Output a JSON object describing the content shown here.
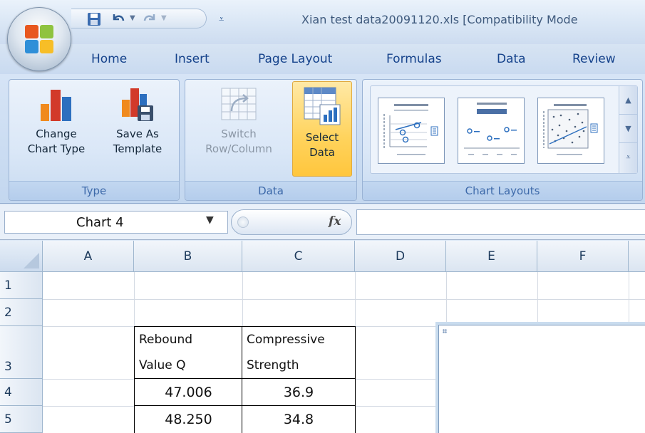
{
  "window": {
    "title": "Xian test data20091120.xls  [Compatibility Mode"
  },
  "tabs": [
    "Home",
    "Insert",
    "Page Layout",
    "Formulas",
    "Data",
    "Review"
  ],
  "ribbon": {
    "groups": {
      "type": {
        "label": "Type",
        "change_chart_type": "Change\nChart Type",
        "save_as_template": "Save As\nTemplate"
      },
      "data": {
        "label": "Data",
        "switch_row_column": "Switch\nRow/Column",
        "select_data": "Select\nData"
      },
      "chart_layouts": {
        "label": "Chart Layouts"
      }
    }
  },
  "formula_bar": {
    "name_box": "Chart 4",
    "fx_label": "fx",
    "formula": ""
  },
  "sheet": {
    "columns": [
      "A",
      "B",
      "C",
      "D",
      "E",
      "F"
    ],
    "rows": [
      "1",
      "2",
      "3",
      "4",
      "5"
    ],
    "cells": {
      "B3": "Rebound\nValue Q",
      "C3": "Compressive\nStrength",
      "B4": "47.006",
      "C4": "36.9",
      "B5": "48.250",
      "C5": "34.8"
    }
  },
  "colors": {
    "accent": "#ffc63d",
    "tab_text": "#15428b",
    "chart_red": "#d23a2a",
    "chart_orange": "#f08a1e",
    "chart_blue": "#2c6fbf"
  }
}
